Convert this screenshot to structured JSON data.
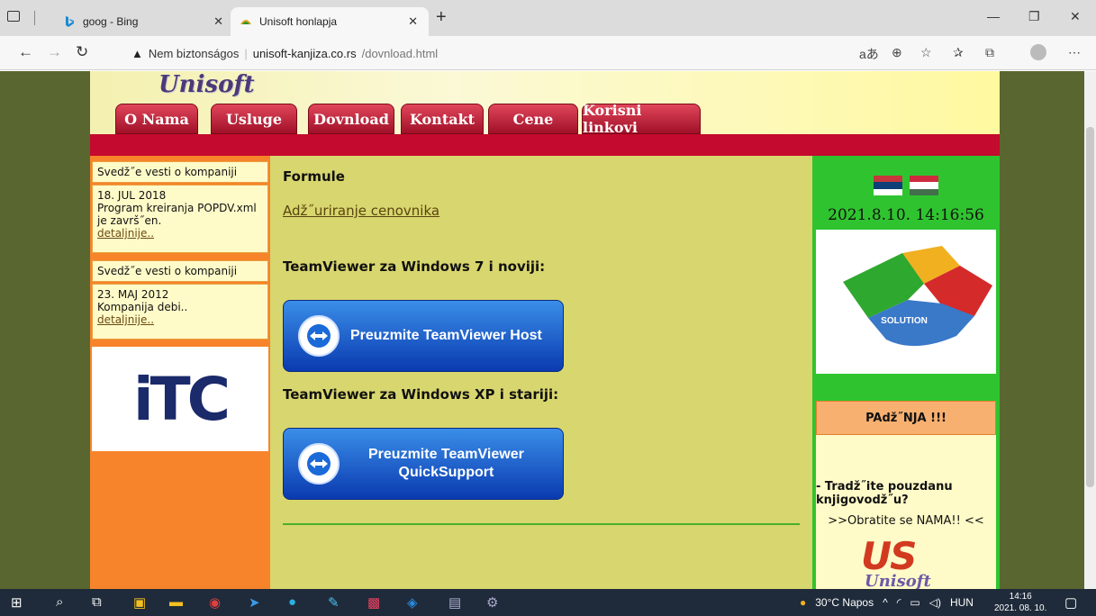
{
  "browser": {
    "tabs": [
      {
        "title": "goog - Bing"
      },
      {
        "title": "Unisoft honlapja"
      }
    ],
    "new_tab": "+",
    "security_label": "Nem biztonságos",
    "url_domain": "unisoft-kanjiza.co.rs",
    "url_path": "/dovnload.html"
  },
  "site": {
    "logo": "Unisoft",
    "nav": [
      "O Nama",
      "Usluge",
      "Dovnload",
      "Kontakt",
      "Cene",
      "Korisni linkovi"
    ],
    "left": {
      "news1_header": "Svedž˝e vesti o kompaniji",
      "news1_date": "18. JUL 2018",
      "news1_text": "Program kreiranja POPDV.xml je završ˝en.",
      "news1_link": "detaljnije..",
      "news2_header": "Svedž˝e vesti o kompaniji",
      "news2_date": "23. MAJ 2012",
      "news2_text": "Kompanija debi..",
      "news2_link": "detaljnije..",
      "itc_logo": "iTC"
    },
    "main": {
      "formule": "Formule",
      "update_link": "Adž˝uriranje cenovnika",
      "tv7_heading": "TeamViewer za Windows 7 i noviji:",
      "tv_host_button": "Preuzmite TeamViewer Host",
      "tvxp_heading": "TeamViewer za Windows XP i stariji:",
      "tv_qs_button_line1": "Preuzmite TeamViewer",
      "tv_qs_button_line2": "QuickSupport"
    },
    "right": {
      "datetime": "2021.8.10. 14:16:56",
      "puzzle_text": "SOLUTION",
      "paznja_title": "PAdž˝NJA !!!",
      "paznja_text": "- Tradž˝ite pouzdanu knjigovodž˝u?",
      "paznja_link": ">>Obratite se NAMA!! <<",
      "us_logo": "US",
      "unisoft_small": "Unisoft"
    }
  },
  "taskbar": {
    "weather": "30°C Napos",
    "language": "HUN",
    "time": "14:16",
    "date": "2021. 08. 10."
  },
  "colors": {
    "page_bg": "#5a6630",
    "red_bar": "#c40a2e",
    "left_col": "#f7842a",
    "main_bg": "#d8d66e",
    "right_col": "#2fc42f"
  }
}
